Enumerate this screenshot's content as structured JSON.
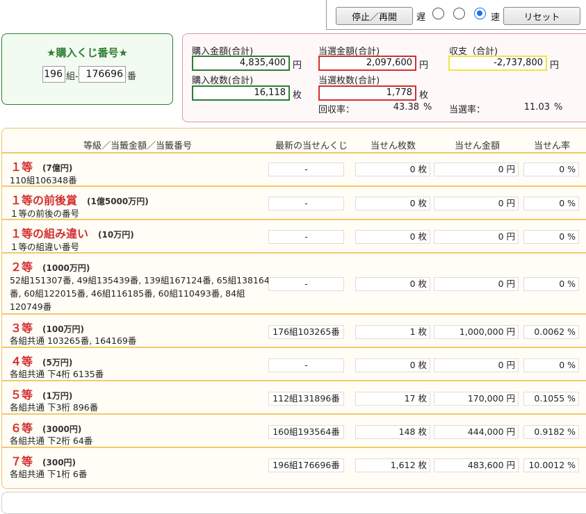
{
  "controls": {
    "stop_resume": "停止／再開",
    "slow": "遅",
    "fast": "速",
    "reset": "リセット",
    "speed_selected": 3
  },
  "ticket": {
    "title": "★購入くじ番号★",
    "group": "196",
    "group_suffix": "組-",
    "number": "176696",
    "number_suffix": "番"
  },
  "summary": {
    "purchase_amount_label": "購入金額(合計)",
    "purchase_amount": "4,835,400",
    "purchase_count_label": "購入枚数(合計)",
    "purchase_count": "16,118",
    "win_amount_label": "当選金額(合計)",
    "win_amount": "2,097,600",
    "win_count_label": "当選枚数(合計)",
    "win_count": "1,778",
    "balance_label": "収支（合計)",
    "balance": "-2,737,800",
    "yen": "円",
    "mai": "枚",
    "return_rate_label": "回収率：",
    "return_rate": "43.38",
    "win_rate_label": "当選率：",
    "win_rate": "11.03",
    "percent": "%",
    "colors": {
      "purchase": "#2e7d32",
      "win": "#d32f2f",
      "balance": "#f0e442"
    }
  },
  "table": {
    "headers": {
      "grade": "等級／当籤金額／当籤番号",
      "latest": "最新の当せんくじ",
      "count": "当せん枚数",
      "amount": "当せん金額",
      "rate": "当せん率"
    },
    "rows": [
      {
        "grade": "１等",
        "amount_label": "(7億円)",
        "desc": "110組106348番",
        "latest": "-",
        "count": "0 枚",
        "amount": "0 円",
        "rate": "0 %"
      },
      {
        "grade": "１等の前後賞",
        "amount_label": "(1億5000万円)",
        "desc": "１等の前後の番号",
        "latest": "-",
        "count": "0 枚",
        "amount": "0 円",
        "rate": "0 %"
      },
      {
        "grade": "１等の組み違い",
        "amount_label": "(10万円)",
        "desc": "１等の組違い番号",
        "latest": "-",
        "count": "0 枚",
        "amount": "0 円",
        "rate": "0 %"
      },
      {
        "grade": "２等",
        "amount_label": "(1000万円)",
        "desc_lines": [
          "52組151307番, 49組135439番, 139組167124番, 65組138164",
          "番, 60組122015番, 46組116185番, 60組110493番, 84組",
          "120749番"
        ],
        "latest": "-",
        "count": "0 枚",
        "amount": "0 円",
        "rate": "0 %"
      },
      {
        "grade": "３等",
        "amount_label": "(100万円)",
        "desc": "各組共通 103265番, 164169番",
        "latest": "176組103265番",
        "count": "1 枚",
        "amount": "1,000,000 円",
        "rate": "0.0062 %"
      },
      {
        "grade": "４等",
        "amount_label": "(5万円)",
        "desc": "各組共通 下4桁 6135番",
        "latest": "-",
        "count": "0 枚",
        "amount": "0 円",
        "rate": "0 %"
      },
      {
        "grade": "５等",
        "amount_label": "(1万円)",
        "desc": "各組共通 下3桁 896番",
        "latest": "112組131896番",
        "count": "17 枚",
        "amount": "170,000 円",
        "rate": "0.1055 %"
      },
      {
        "grade": "６等",
        "amount_label": "(3000円)",
        "desc": "各組共通 下2桁 64番",
        "latest": "160組193564番",
        "count": "148 枚",
        "amount": "444,000 円",
        "rate": "0.9182 %"
      },
      {
        "grade": "７等",
        "amount_label": "(300円)",
        "desc": "各組共通 下1桁 6番",
        "latest": "196組176696番",
        "count": "1,612 枚",
        "amount": "483,600 円",
        "rate": "10.0012 %"
      }
    ]
  }
}
